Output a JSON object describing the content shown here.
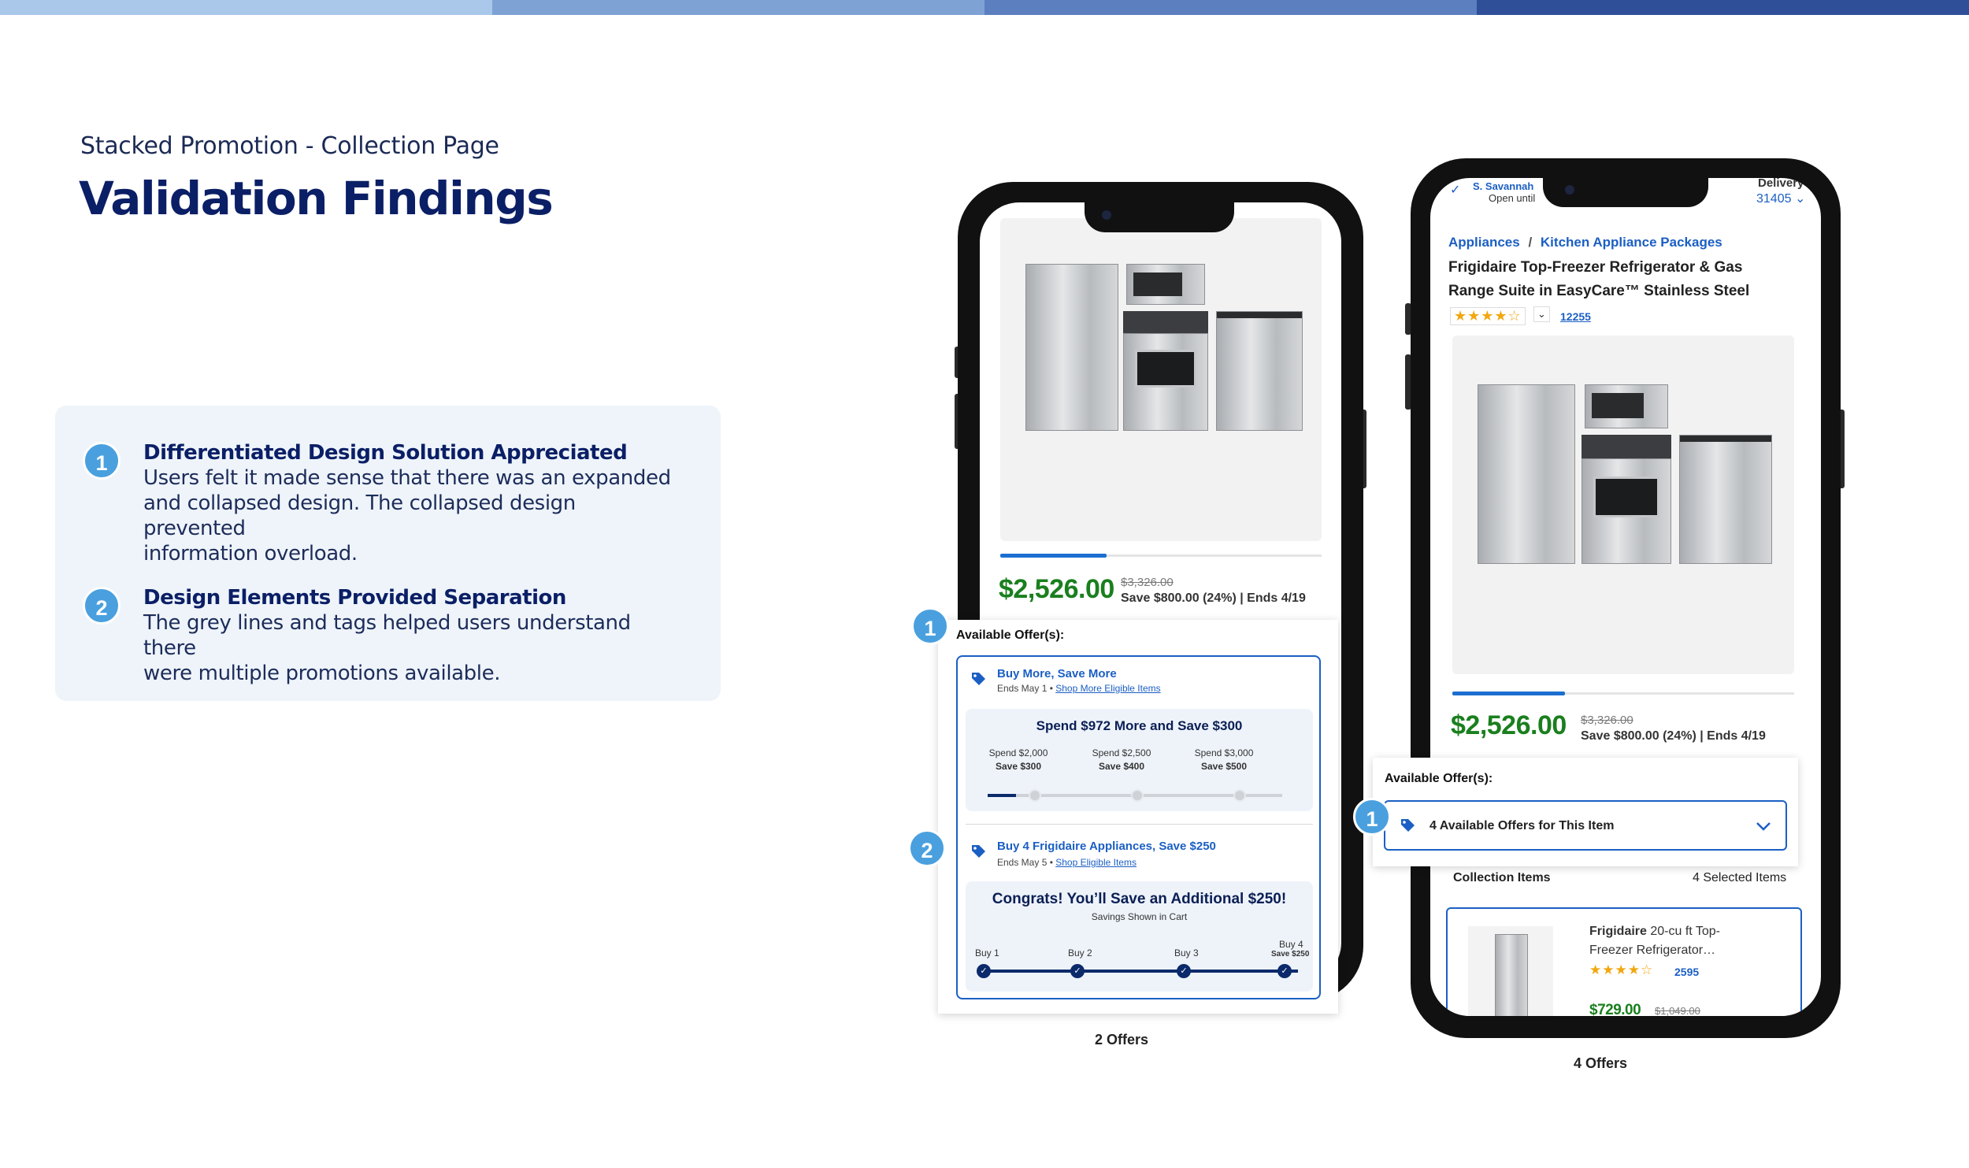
{
  "topbar_colors": [
    "#a9c8ea",
    "#7fa2d4",
    "#5b7fbf",
    "#2f4f99"
  ],
  "header": {
    "subtitle": "Stacked Promotion - Collection Page",
    "title": "Validation Findings"
  },
  "findings": [
    {
      "number": "1",
      "heading": "Differentiated Design Solution Appreciated",
      "body_lines": [
        "Users felt it made sense that there was an expanded",
        "and collapsed design. The collapsed design prevented",
        "information overload."
      ]
    },
    {
      "number": "2",
      "heading": "Design Elements Provided Separation",
      "body_lines": [
        "The grey lines and tags helped users understand there",
        "were multiple promotions available."
      ]
    }
  ],
  "phone1": {
    "price": "$2,526.00",
    "old_price": "$3,326.00",
    "save_line": "Save $800.00 (24%) | Ends 4/19",
    "image_progress": 0.33,
    "offers_label": "Available Offer(s):",
    "badge1": "1",
    "badge2": "2",
    "offer1": {
      "title": "Buy More, Save More",
      "ends": "Ends May 1 • ",
      "link": "Shop More Eligible Items",
      "headline": "Spend $972 More and Save $300",
      "tiers": [
        {
          "spend": "Spend $2,000",
          "save": "Save $300"
        },
        {
          "spend": "Spend $2,500",
          "save": "Save $400"
        },
        {
          "spend": "Spend $3,000",
          "save": "Save $500"
        }
      ]
    },
    "offer2": {
      "title": "Buy 4 Frigidaire Appliances, Save $250",
      "ends": "Ends May 5 • ",
      "link": "Shop Eligible Items",
      "headline": "Congrats! You’ll Save an Additional $250!",
      "subline": "Savings Shown in Cart",
      "steps": [
        "Buy 1",
        "Buy 2",
        "Buy 3",
        "Buy 4"
      ],
      "last_save": "Save $250"
    },
    "caption": "2 Offers"
  },
  "phone2": {
    "store_name": "S. Savannah",
    "store_status": "Open until",
    "delivery_label": "Delivery",
    "zip": "31405",
    "breadcrumb": [
      "Appliances",
      "Kitchen Appliance Packages"
    ],
    "breadcrumb_sep": "/",
    "title_lines": [
      "Frigidaire Top-Freezer Refrigerator & Gas",
      "Range Suite in EasyCare™ Stainless Steel"
    ],
    "rating": 4.5,
    "stars_text": "★★★★☆",
    "reviews": "12255",
    "image_progress": 0.33,
    "price": "$2,526.00",
    "old_price": "$3,326.00",
    "save_line": "Save $800.00 (24%) | Ends 4/19",
    "offers_label": "Available Offer(s):",
    "badge": "1",
    "collapsed_label": "4 Available Offers for This Item",
    "collection_label": "Collection Items",
    "selected_count": "4 Selected Items",
    "item": {
      "brand": "Frigidaire",
      "name_rest": " 20-cu ft Top-",
      "name_line2": "Freezer Refrigerator…",
      "stars_text": "★★★★☆",
      "reviews": "2595",
      "price": "$729.00",
      "old_price": "$1,049.00"
    },
    "caption": "4 Offers"
  }
}
